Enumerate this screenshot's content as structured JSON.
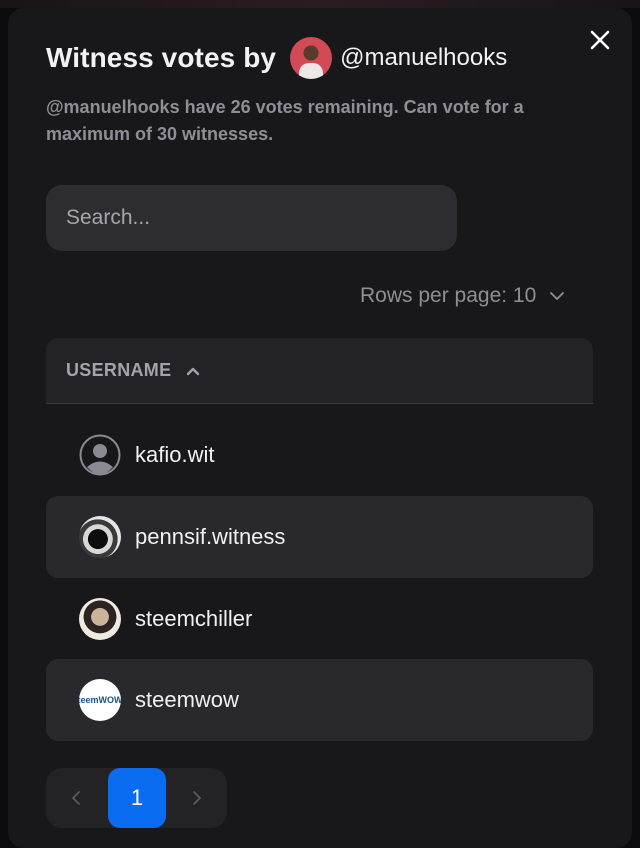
{
  "modal": {
    "title": "Witness votes by",
    "account_handle": "@manuelhooks",
    "subtitle": "@manuelhooks have 26 votes remaining. Can vote for a maximum of 30 witnesses."
  },
  "search": {
    "placeholder": "Search...",
    "value": ""
  },
  "rows_per_page": {
    "label": "Rows per page: 10"
  },
  "table": {
    "column_header": "USERNAME",
    "sort": "ascending",
    "rows": [
      {
        "username": "kafio.wit",
        "avatar": "default-user-icon"
      },
      {
        "username": "pennsif.witness",
        "avatar": "photo"
      },
      {
        "username": "steemchiller",
        "avatar": "photo"
      },
      {
        "username": "steemwow",
        "avatar": "logo"
      }
    ]
  },
  "pagination": {
    "current_page": "1"
  },
  "avatars": {
    "steemwow_logo_text": "teemWOW"
  },
  "colors": {
    "accent": "#0a6cf0",
    "modal_bg": "#18181b",
    "row_alt_bg": "#28282d"
  }
}
